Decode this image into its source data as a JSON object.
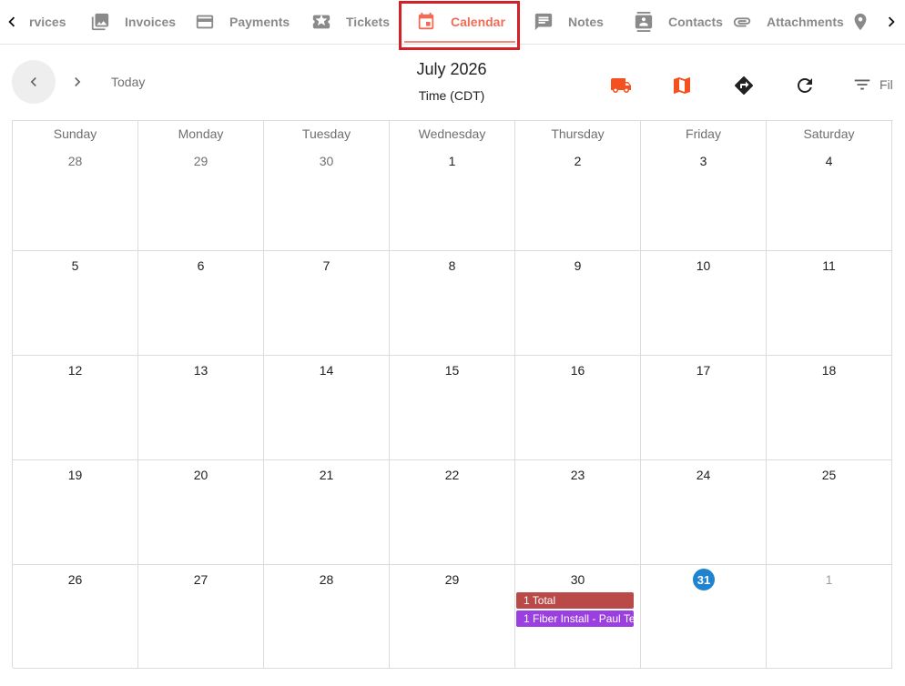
{
  "tabs": {
    "items": [
      {
        "label": "rvices",
        "icon": "services-icon"
      },
      {
        "label": "Invoices",
        "icon": "photo-library-icon"
      },
      {
        "label": "Payments",
        "icon": "credit-card-icon"
      },
      {
        "label": "Tickets",
        "icon": "ticket-star-icon"
      },
      {
        "label": "Calendar",
        "icon": "calendar-icon",
        "active": true
      },
      {
        "label": "Notes",
        "icon": "comment-icon"
      },
      {
        "label": "Contacts",
        "icon": "contact-card-icon"
      },
      {
        "label": "Attachments",
        "icon": "paperclip-icon"
      },
      {
        "label": "",
        "icon": "map-pin-icon"
      }
    ],
    "active_color": "#ef6c57",
    "highlight_color": "#d42027"
  },
  "toolbar": {
    "today_label": "Today",
    "title": "July 2026",
    "subtitle": "Time (CDT)",
    "filter_label": "Fil",
    "tools": [
      {
        "icon": "truck-icon",
        "color": "#f4511e"
      },
      {
        "icon": "map-icon",
        "color": "#f4511e"
      },
      {
        "icon": "directions-icon",
        "color": "#212121"
      },
      {
        "icon": "refresh-icon",
        "color": "#212121"
      }
    ]
  },
  "calendar": {
    "weekdays": [
      "Sunday",
      "Monday",
      "Tuesday",
      "Wednesday",
      "Thursday",
      "Friday",
      "Saturday"
    ],
    "weeks": [
      [
        {
          "day": "28",
          "state": "prev"
        },
        {
          "day": "29",
          "state": "prev"
        },
        {
          "day": "30",
          "state": "prev"
        },
        {
          "day": "1"
        },
        {
          "day": "2"
        },
        {
          "day": "3"
        },
        {
          "day": "4"
        }
      ],
      [
        {
          "day": "5"
        },
        {
          "day": "6"
        },
        {
          "day": "7"
        },
        {
          "day": "8"
        },
        {
          "day": "9"
        },
        {
          "day": "10"
        },
        {
          "day": "11"
        }
      ],
      [
        {
          "day": "12"
        },
        {
          "day": "13"
        },
        {
          "day": "14"
        },
        {
          "day": "15"
        },
        {
          "day": "16"
        },
        {
          "day": "17"
        },
        {
          "day": "18"
        }
      ],
      [
        {
          "day": "19"
        },
        {
          "day": "20"
        },
        {
          "day": "21"
        },
        {
          "day": "22"
        },
        {
          "day": "23"
        },
        {
          "day": "24"
        },
        {
          "day": "25"
        }
      ],
      [
        {
          "day": "26"
        },
        {
          "day": "27"
        },
        {
          "day": "28"
        },
        {
          "day": "29"
        },
        {
          "day": "30",
          "events": [
            {
              "label": "1 Total",
              "color": "#b94a48"
            },
            {
              "label": "1 Fiber Install - Paul Te",
              "color": "#9b3fe0"
            }
          ]
        },
        {
          "day": "31",
          "state": "today"
        },
        {
          "day": "1",
          "state": "next"
        }
      ]
    ],
    "today_color": "#1f84cf"
  }
}
